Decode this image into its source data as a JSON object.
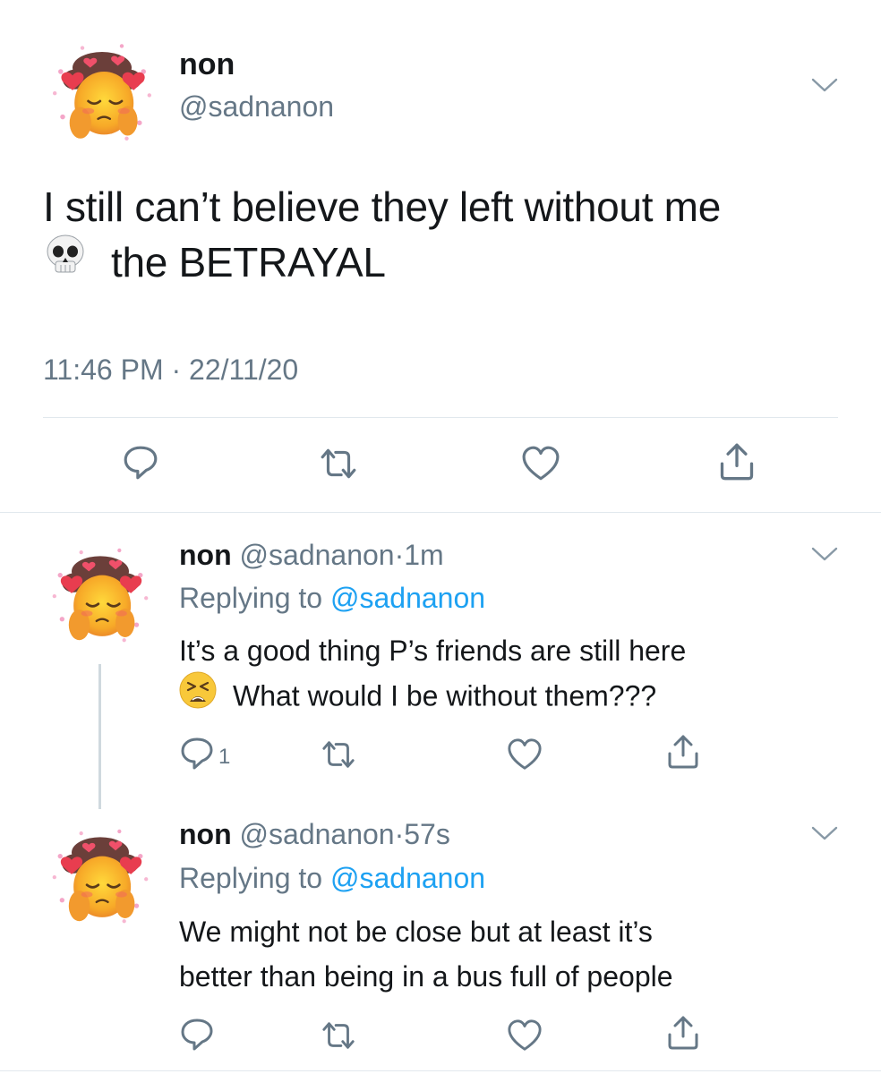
{
  "main_tweet": {
    "name": "non",
    "handle": "@sadnanon",
    "text_line1": "I still can’t believe they left without me",
    "text_line2": "the BETRAYAL",
    "emoji": "skull-emoji",
    "time": "11:46 PM",
    "separator": "·",
    "date": "22/11/20"
  },
  "replies": [
    {
      "name": "non",
      "handle": "@sadnanon",
      "separator": "·",
      "time": "1m",
      "replying_prefix": "Replying to",
      "replying_to": "@sadnanon",
      "text_line1": "It’s a good thing P’s friends are still here",
      "text_line2": "What would I be without them???",
      "emoji": "tired-face-emoji",
      "reply_count": "1"
    },
    {
      "name": "non",
      "handle": "@sadnanon",
      "separator": "·",
      "time": "57s",
      "replying_prefix": "Replying to",
      "replying_to": "@sadnanon",
      "text_line1": "We might not be close but at least it’s",
      "text_line2": "better than being in a bus full of people"
    }
  ],
  "icons": {
    "reply": "reply-icon",
    "retweet": "retweet-icon",
    "like": "heart-icon",
    "share": "share-icon",
    "more": "chevron-down-icon"
  },
  "colors": {
    "text": "#14171a",
    "secondary": "#657786",
    "link": "#1da1f2",
    "divider": "#e1e8ed"
  }
}
